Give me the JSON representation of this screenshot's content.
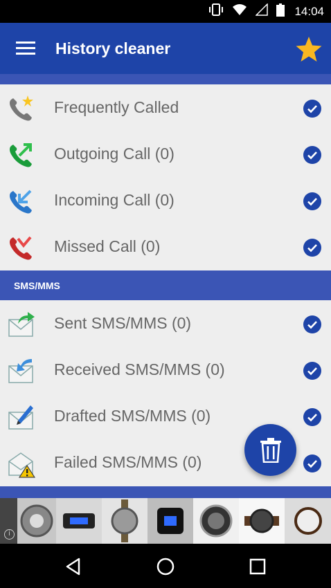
{
  "status_bar": {
    "time": "14:04"
  },
  "app_bar": {
    "title": "History cleaner"
  },
  "calls": [
    {
      "label": "Frequently Called",
      "icon": "phone-star-icon",
      "checked": true
    },
    {
      "label": "Outgoing Call (0)",
      "icon": "outgoing-call-icon",
      "checked": true
    },
    {
      "label": "Incoming Call (0)",
      "icon": "incoming-call-icon",
      "checked": true
    },
    {
      "label": "Missed Call (0)",
      "icon": "missed-call-icon",
      "checked": true
    }
  ],
  "sms_section": {
    "header": "SMS/MMS"
  },
  "sms": [
    {
      "label": "Sent SMS/MMS (0)",
      "icon": "sent-mail-icon",
      "checked": true
    },
    {
      "label": "Received SMS/MMS (0)",
      "icon": "received-mail-icon",
      "checked": true
    },
    {
      "label": "Drafted SMS/MMS (0)",
      "icon": "draft-mail-icon",
      "checked": true
    },
    {
      "label": "Failed SMS/MMS (0)",
      "icon": "failed-mail-icon",
      "checked": true
    }
  ],
  "colors": {
    "primary": "#1e44a8",
    "accent_band": "#3b55b5",
    "star": "#f9b821",
    "check": "#1e44a8"
  },
  "ad": {
    "content": "watch-product-thumbnails"
  }
}
